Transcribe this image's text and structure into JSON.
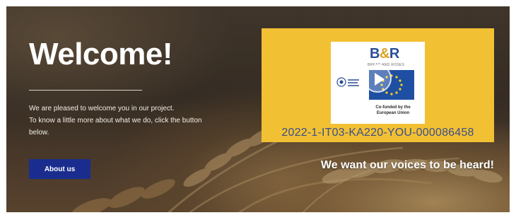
{
  "hero": {
    "title": "Welcome!",
    "intro_lines": [
      "We are pleased to welcome you in our project.",
      "To know a little more about what we do, click the button",
      "below."
    ],
    "about_button_label": "About us",
    "slogan": "We want our voices to be heard!"
  },
  "video": {
    "logo_title_b": "B",
    "logo_title_amp": "&",
    "logo_title_r": "R",
    "logo_subtitle": "BREAD AND ROSES",
    "eu_cofunded": "Co-funded by the European Union",
    "project_code": "2022-1-IT03-KA220-YOU-000086458"
  },
  "colors": {
    "accent_button": "#1a2d8f",
    "video_background": "#f2c033",
    "project_code_text": "#3a4f8c"
  },
  "icons": {
    "play": "play-icon",
    "eu_flag": "eu-flag-icon",
    "agency_logo": "agency-logo-icon"
  }
}
